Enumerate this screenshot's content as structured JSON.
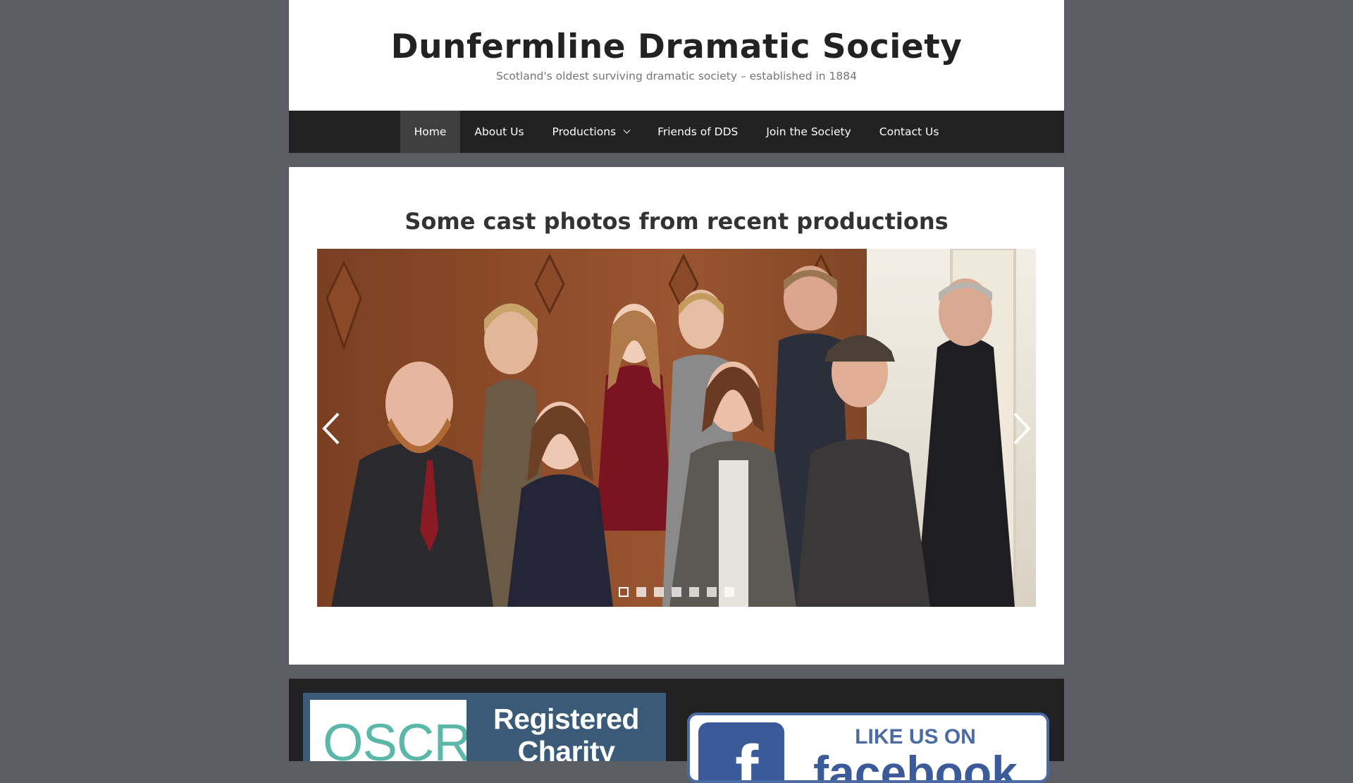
{
  "header": {
    "title": "Dunfermline Dramatic Society",
    "description": "Scotland's oldest surviving dramatic society – established in 1884"
  },
  "nav": {
    "items": [
      {
        "label": "Home",
        "active": true
      },
      {
        "label": "About Us"
      },
      {
        "label": "Productions",
        "has_dropdown": true
      },
      {
        "label": "Friends of DDS"
      },
      {
        "label": "Join the Society"
      },
      {
        "label": "Contact Us"
      }
    ]
  },
  "content": {
    "heading": "Some cast photos from recent productions",
    "slider": {
      "slide_count": 7,
      "active_slide": 1,
      "image": "cast-group-photo",
      "prev_icon": "chevron-left-icon",
      "next_icon": "chevron-right-icon"
    }
  },
  "footer": {
    "oscr": {
      "logo_text": "OSCR",
      "label": "Registered Charity"
    },
    "facebook": {
      "like_text": "LIKE US ON",
      "brand_text": "facebook",
      "logo_glyph": "f"
    }
  },
  "colors": {
    "background": "#5c5c65",
    "nav_bg": "#222222",
    "nav_active_bg": "#3f3f3f",
    "title_color": "#222222",
    "facebook_blue": "#3b5a99",
    "oscr_teal": "#5bb8a8"
  }
}
